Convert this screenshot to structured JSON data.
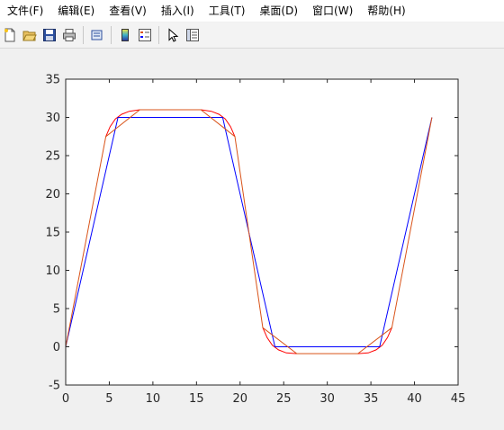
{
  "menu": {
    "items": [
      "文件(F)",
      "编辑(E)",
      "查看(V)",
      "插入(I)",
      "工具(T)",
      "桌面(D)",
      "窗口(W)",
      "帮助(H)"
    ]
  },
  "toolbar": {
    "icons": [
      "new-file-icon",
      "open-folder-icon",
      "save-icon",
      "print-icon",
      "print-preview-icon",
      "colorbar-icon",
      "legend-icon",
      "pointer-icon",
      "property-inspector-icon"
    ]
  },
  "colors": {
    "blue_series": "#0000ff",
    "orange_series": "#d95319",
    "red_arcs": "#ff0000"
  },
  "chart_data": {
    "type": "line",
    "xlim": [
      0,
      45
    ],
    "ylim": [
      -5,
      35
    ],
    "xticks": [
      "0",
      "5",
      "10",
      "15",
      "20",
      "25",
      "30",
      "35",
      "40",
      "45"
    ],
    "yticks": [
      "-5",
      "0",
      "5",
      "10",
      "15",
      "20",
      "25",
      "30",
      "35"
    ],
    "grid": false,
    "series": [
      {
        "color": "blue",
        "x": [
          0,
          6,
          18,
          24,
          36,
          42
        ],
        "y": [
          0,
          30,
          30,
          0,
          0,
          30
        ]
      },
      {
        "color": "orange",
        "x": [
          0,
          4.6,
          8.5,
          15.5,
          19.4,
          22.6,
          26.5,
          33.5,
          37.4,
          42
        ],
        "y": [
          0,
          27.5,
          31,
          31,
          27.5,
          2.5,
          -0.9,
          -0.9,
          2.5,
          30
        ]
      }
    ],
    "arcs": [
      {
        "color": "red",
        "x": [
          4.6,
          5.1,
          5.7,
          6.4,
          7.3,
          8.5
        ],
        "y": [
          27.5,
          28.8,
          29.8,
          30.4,
          30.8,
          31.0
        ]
      },
      {
        "color": "red",
        "x": [
          15.5,
          16.7,
          17.6,
          18.3,
          18.9,
          19.4
        ],
        "y": [
          31.0,
          30.8,
          30.4,
          29.8,
          28.8,
          27.5
        ]
      },
      {
        "color": "red",
        "x": [
          22.6,
          23.1,
          23.7,
          24.4,
          25.3,
          26.5
        ],
        "y": [
          2.5,
          1.2,
          0.2,
          -0.4,
          -0.8,
          -0.9
        ]
      },
      {
        "color": "red",
        "x": [
          33.5,
          34.7,
          35.6,
          36.3,
          36.9,
          37.4
        ],
        "y": [
          -0.9,
          -0.8,
          -0.4,
          0.2,
          1.2,
          2.5
        ]
      }
    ]
  }
}
